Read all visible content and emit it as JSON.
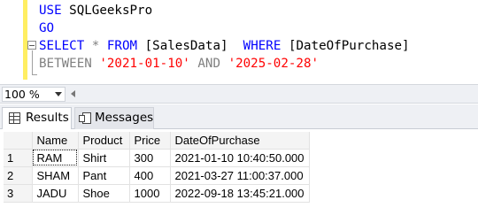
{
  "editor": {
    "line1": {
      "kw1": "USE",
      "ident": "SQLGeeksPro"
    },
    "line2": {
      "kw1": "GO"
    },
    "line3": {
      "kw1": "SELECT",
      "star": "*",
      "kw2": "FROM",
      "table": "[SalesData]",
      "kw3": "WHERE",
      "column": "[DateOfPurchase]"
    },
    "line4": {
      "kw1": "BETWEEN",
      "str1": "'2021-01-10'",
      "kw2": "AND",
      "str2": "'2025-02-28'"
    }
  },
  "zoom": {
    "value": "100 %"
  },
  "tabs": [
    {
      "label": "Results",
      "icon": "grid-icon",
      "active": true
    },
    {
      "label": "Messages",
      "icon": "messages-icon",
      "active": false
    }
  ],
  "results": {
    "columns": [
      "Name",
      "Product",
      "Price",
      "DateOfPurchase"
    ],
    "rows": [
      {
        "num": "1",
        "cells": [
          "RAM",
          "Shirt",
          "300",
          "2021-01-10 10:40:50.000"
        ]
      },
      {
        "num": "2",
        "cells": [
          "SHAM",
          "Pant",
          "400",
          "2021-03-27 11:00:37.000"
        ]
      },
      {
        "num": "3",
        "cells": [
          "JADU",
          "Shoe",
          "1000",
          "2022-09-18 13:45:21.000"
        ]
      }
    ]
  },
  "colors": {
    "keyword": "#0000ff",
    "string": "#ff0000",
    "operator": "#808080",
    "change_bar": "#ffee62"
  }
}
